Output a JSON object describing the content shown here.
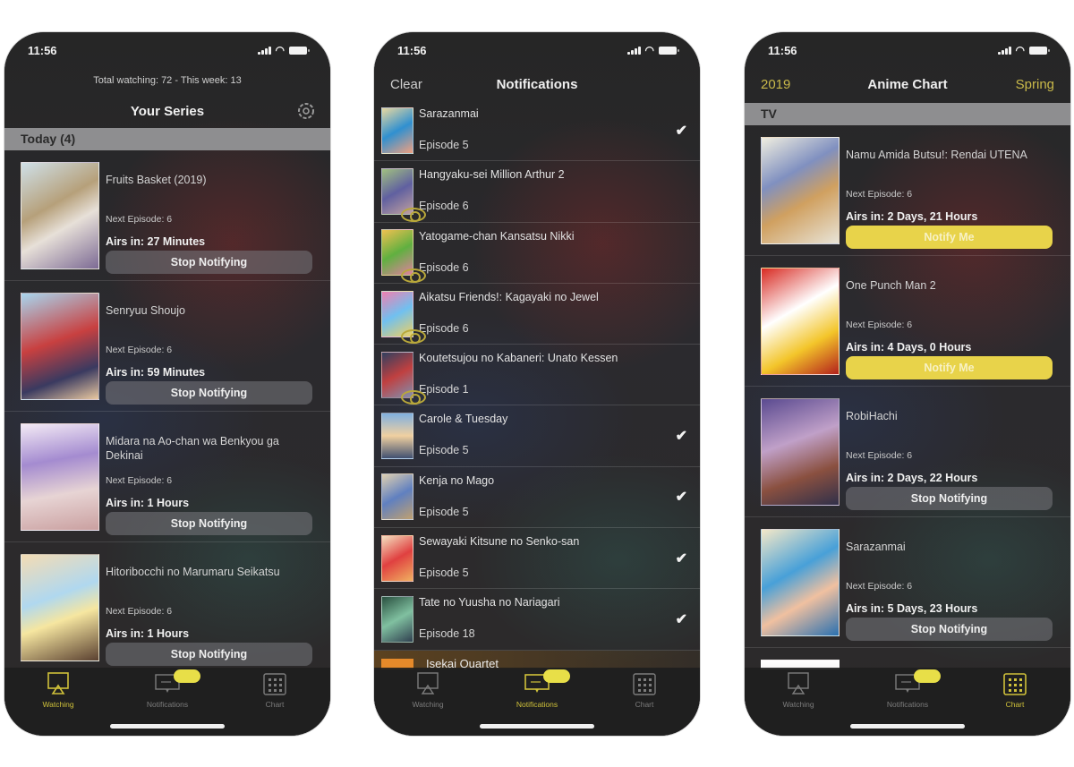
{
  "status_bar": {
    "time": "11:56"
  },
  "phones": {
    "watching": {
      "subtitle": "Total watching: 72 - This week:  13",
      "title": "Your Series",
      "section": "Today (4)",
      "series": [
        {
          "title": "Fruits Basket (2019)",
          "next": "Next Episode: 6",
          "airs": "Airs in: 27 Minutes",
          "button": "Stop Notifying"
        },
        {
          "title": "Senryuu Shoujo",
          "next": "Next Episode: 6",
          "airs": "Airs in: 59 Minutes",
          "button": "Stop Notifying"
        },
        {
          "title": "Midara na Ao-chan wa Benkyou ga Dekinai",
          "next": "Next Episode: 6",
          "airs": "Airs in: 1 Hours",
          "button": "Stop Notifying"
        },
        {
          "title": "Hitoribocchi no Marumaru Seikatsu",
          "next": "Next Episode: 6",
          "airs": "Airs in: 1 Hours",
          "button": "Stop Notifying"
        }
      ]
    },
    "notifications": {
      "left_button": "Clear",
      "title": "Notifications",
      "items": [
        {
          "title": "Sarazanmai",
          "episode": "Episode 5",
          "status": "watched"
        },
        {
          "title": "Hangyaku-sei Million Arthur 2",
          "episode": "Episode 6",
          "status": "unwatched"
        },
        {
          "title": "Yatogame-chan Kansatsu Nikki",
          "episode": "Episode 6",
          "status": "unwatched"
        },
        {
          "title": "Aikatsu Friends!: Kagayaki no Jewel",
          "episode": "Episode 6",
          "status": "unwatched"
        },
        {
          "title": "Koutetsujou no Kabaneri: Unato Kessen",
          "episode": "Episode 1",
          "status": "unwatched"
        },
        {
          "title": "Carole & Tuesday",
          "episode": "Episode 5",
          "status": "watched"
        },
        {
          "title": "Kenja no Mago",
          "episode": "Episode 5",
          "status": "watched"
        },
        {
          "title": "Sewayaki Kitsune no Senko-san",
          "episode": "Episode 5",
          "status": "watched"
        },
        {
          "title": "Tate no Yuusha no Nariagari",
          "episode": "Episode 18",
          "status": "watched"
        }
      ],
      "partial_item": "Isekai Quartet"
    },
    "chart": {
      "left_button": "2019",
      "title": "Anime Chart",
      "right_button": "Spring",
      "section": "TV",
      "series": [
        {
          "title": "Namu Amida Butsu!: Rendai UTENA",
          "next": "Next Episode: 6",
          "airs": "Airs in: 2 Days, 21 Hours",
          "button": "Notify Me"
        },
        {
          "title": "One Punch Man 2",
          "next": "Next Episode: 6",
          "airs": "Airs in: 4 Days, 0 Hours",
          "button": "Notify Me"
        },
        {
          "title": "RobiHachi",
          "next": "Next Episode: 6",
          "airs": "Airs in: 2 Days, 22 Hours",
          "button": "Stop Notifying"
        },
        {
          "title": "Sarazanmai",
          "next": "Next Episode: 6",
          "airs": "Airs in: 5 Days, 23 Hours",
          "button": "Stop Notifying"
        }
      ]
    }
  },
  "tab_bar": {
    "tabs": [
      {
        "label": "Watching",
        "icon": "airplay-icon"
      },
      {
        "label": "Notifications",
        "icon": "message-icon"
      },
      {
        "label": "Chart",
        "icon": "calendar-icon"
      }
    ],
    "badge": "..."
  },
  "colors": {
    "accent": "#e8d34a",
    "accent_text": "#cfc13a",
    "section_header_bg": "#8e8e90",
    "button_bg": "#6e6e72"
  }
}
